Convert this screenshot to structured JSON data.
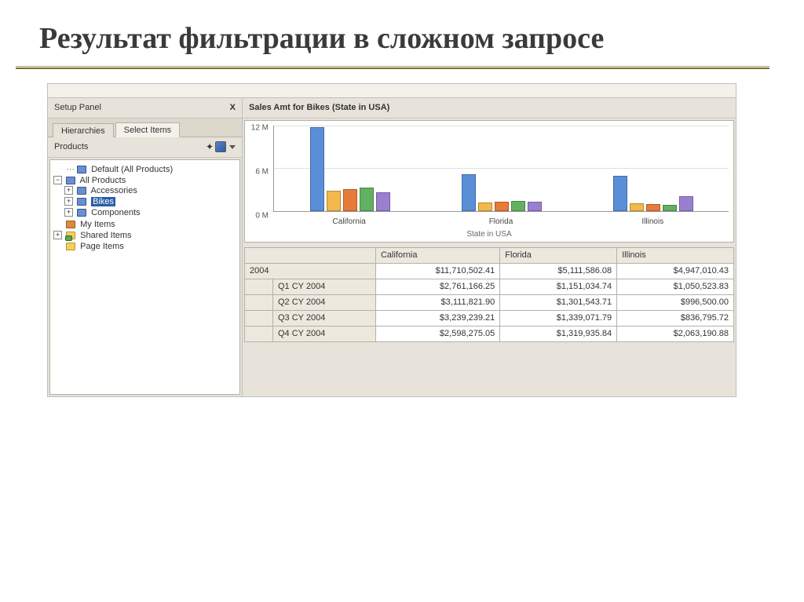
{
  "slide": {
    "title": "Результат фильтрации в сложном запросе"
  },
  "setup": {
    "panel_title": "Setup Panel",
    "close": "X",
    "tabs": {
      "hierarchies": "Hierarchies",
      "select_items": "Select Items"
    },
    "products_label": "Products"
  },
  "tree": {
    "default_all": "Default (All Products)",
    "all_products": "All Products",
    "accessories": "Accessories",
    "bikes": "Bikes",
    "components": "Components",
    "my_items": "My Items",
    "shared_items": "Shared Items",
    "page_items": "Page Items"
  },
  "chart_title": "Sales Amt for Bikes (State in USA)",
  "chart_data": {
    "type": "bar",
    "title": "Sales Amt for Bikes (State in USA)",
    "xlabel": "State in USA",
    "ylabel": "",
    "ylim": [
      0,
      12
    ],
    "yticks": [
      "0 M",
      "6 M",
      "12 M"
    ],
    "categories": [
      "California",
      "Florida",
      "Illinois"
    ],
    "series": [
      {
        "name": "2004",
        "color": "#5a8fd8",
        "values": [
          11.8,
          5.1,
          4.9
        ]
      },
      {
        "name": "Q1 CY 2004",
        "color": "#f2b84b",
        "values": [
          2.8,
          1.15,
          1.05
        ]
      },
      {
        "name": "Q2 CY 2004",
        "color": "#e87a3a",
        "values": [
          3.1,
          1.3,
          1.0
        ]
      },
      {
        "name": "Q3 CY 2004",
        "color": "#62b162",
        "values": [
          3.25,
          1.35,
          0.85
        ]
      },
      {
        "name": "Q4 CY 2004",
        "color": "#9a7fd1",
        "values": [
          2.6,
          1.3,
          2.05
        ]
      }
    ]
  },
  "grid": {
    "columns": [
      "California",
      "Florida",
      "Illinois"
    ],
    "rows": [
      {
        "label": "2004",
        "indent": 0,
        "values": [
          "$11,710,502.41",
          "$5,111,586.08",
          "$4,947,010.43"
        ]
      },
      {
        "label": "Q1 CY 2004",
        "indent": 1,
        "values": [
          "$2,761,166.25",
          "$1,151,034.74",
          "$1,050,523.83"
        ]
      },
      {
        "label": "Q2 CY 2004",
        "indent": 1,
        "values": [
          "$3,111,821.90",
          "$1,301,543.71",
          "$996,500.00"
        ]
      },
      {
        "label": "Q3 CY 2004",
        "indent": 1,
        "values": [
          "$3,239,239.21",
          "$1,339,071.79",
          "$836,795.72"
        ]
      },
      {
        "label": "Q4 CY 2004",
        "indent": 1,
        "values": [
          "$2,598,275.05",
          "$1,319,935.84",
          "$2,063,190.88"
        ]
      }
    ]
  }
}
